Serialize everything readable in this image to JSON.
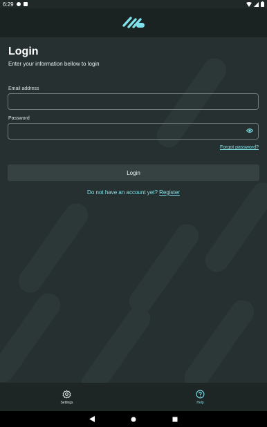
{
  "status": {
    "time": "6:29"
  },
  "colors": {
    "accent": "#7fe2ea",
    "background": "#263030",
    "appbar": "#1b2222"
  },
  "login": {
    "title": "Login",
    "subtitle": "Enter your information bellow to login",
    "email_label": "Email address",
    "email_value": "",
    "password_label": "Password",
    "password_value": "",
    "forgot": "Forgot password?",
    "button": "Login",
    "no_account": "Do not have an account yet?",
    "register": "Register"
  },
  "nav": {
    "items": [
      {
        "label": "Settings",
        "icon": "gear-icon"
      },
      {
        "label": "Help",
        "icon": "help-icon"
      }
    ]
  },
  "sysnav": {
    "back": "back-icon",
    "home": "home-icon",
    "recents": "recents-icon"
  }
}
